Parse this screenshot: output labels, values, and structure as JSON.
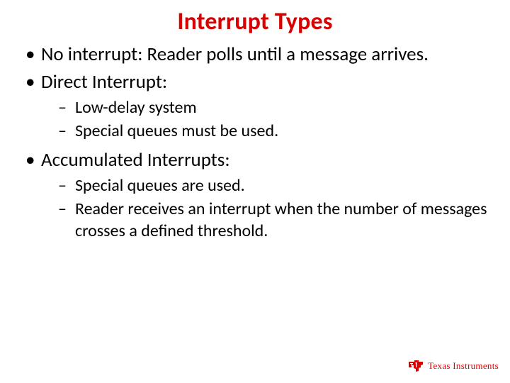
{
  "title": "Interrupt Types",
  "bullets": {
    "b0": "No interrupt: Reader polls until a message arrives.",
    "b1": "Direct Interrupt:",
    "b1_sub": {
      "s0": "Low-delay system",
      "s1": "Special queues must be used."
    },
    "b2": "Accumulated Interrupts:",
    "b2_sub": {
      "s0": "Special queues are used.",
      "s1": "Reader receives an interrupt when the number of messages crosses a defined threshold."
    }
  },
  "logo": {
    "company": "Texas Instruments"
  }
}
